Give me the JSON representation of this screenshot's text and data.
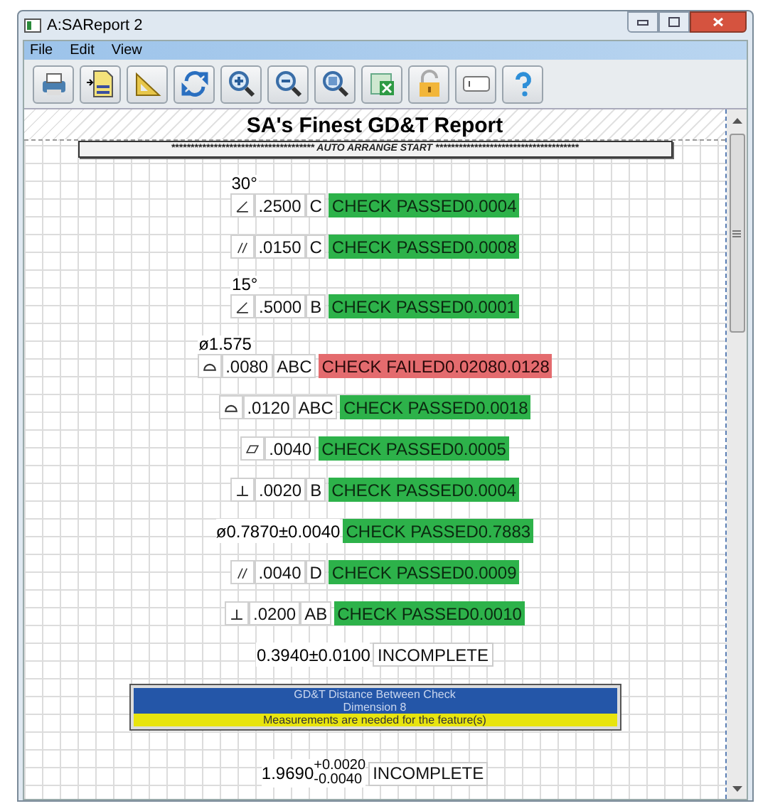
{
  "window": {
    "title": "A:SAReport 2"
  },
  "menu": [
    "File",
    "Edit",
    "View"
  ],
  "toolbar": [
    {
      "kind": "print"
    },
    {
      "kind": "pdf"
    },
    {
      "kind": "ruler"
    },
    {
      "kind": "refresh"
    },
    {
      "kind": "zoom_in"
    },
    {
      "kind": "zoom_out"
    },
    {
      "kind": "zoom_fit"
    },
    {
      "kind": "spreadsheet"
    },
    {
      "kind": "lock"
    },
    {
      "kind": "field"
    },
    {
      "kind": "help"
    }
  ],
  "report": {
    "title": "SA's Finest GD&T Report",
    "banner": "************************************* AUTO ARRANGE START *************************************",
    "items": [
      {
        "kind": "frame",
        "label": "30°",
        "symbol": {
          "kind": "angularity"
        },
        "tolerance": ".2500",
        "datums": "C",
        "status": {
          "kind": "passed",
          "text": "CHECK PASSED0.0004"
        }
      },
      {
        "kind": "frame",
        "symbol": {
          "kind": "parallelism"
        },
        "tolerance": ".0150",
        "datums": "C",
        "status": {
          "kind": "passed",
          "text": "CHECK PASSED0.0008"
        }
      },
      {
        "kind": "frame",
        "label": "15°",
        "symbol": {
          "kind": "angularity"
        },
        "tolerance": ".5000",
        "datums": "B",
        "status": {
          "kind": "passed",
          "text": "CHECK PASSED0.0001"
        }
      },
      {
        "kind": "frame",
        "label": "ø1.575",
        "symbol": {
          "kind": "profile"
        },
        "tolerance": ".0080",
        "datums": "ABC",
        "status": {
          "kind": "failed",
          "text": "CHECK FAILED0.02080.0128"
        }
      },
      {
        "kind": "frame",
        "symbol": {
          "kind": "profile"
        },
        "tolerance": ".0120",
        "datums": "ABC",
        "status": {
          "kind": "passed",
          "text": "CHECK PASSED0.0018"
        }
      },
      {
        "kind": "frame",
        "symbol": {
          "kind": "flatness"
        },
        "tolerance": ".0040",
        "status": {
          "kind": "passed",
          "text": "CHECK PASSED0.0005"
        }
      },
      {
        "kind": "frame",
        "symbol": {
          "kind": "perpendicularity"
        },
        "tolerance": ".0020",
        "datums": "B",
        "status": {
          "kind": "passed",
          "text": "CHECK PASSED0.0004"
        }
      },
      {
        "kind": "dimension",
        "value": "ø0.7870±0.0040",
        "status": {
          "kind": "passed",
          "text": "CHECK PASSED0.7883"
        }
      },
      {
        "kind": "frame",
        "symbol": {
          "kind": "parallelism"
        },
        "tolerance": ".0040",
        "datums": "D",
        "status": {
          "kind": "passed",
          "text": "CHECK PASSED0.0009"
        }
      },
      {
        "kind": "frame",
        "symbol": {
          "kind": "perpendicularity"
        },
        "tolerance": ".0200",
        "datums": "AB",
        "status": {
          "kind": "passed",
          "text": "CHECK PASSED0.0010"
        }
      },
      {
        "kind": "dimension",
        "value": "0.3940±0.0100",
        "status": {
          "kind": "incomplete",
          "text": "INCOMPLETE"
        }
      },
      {
        "kind": "notice",
        "title": "GD&T Distance Between Check",
        "subtitle": "Dimension 8",
        "message": "Measurements are needed for the feature(s)"
      },
      {
        "kind": "dimension",
        "value": "1.9690",
        "upper": "+0.0020",
        "lower": "-0.0040",
        "status": {
          "kind": "incomplete",
          "text": "INCOMPLETE"
        }
      }
    ]
  }
}
